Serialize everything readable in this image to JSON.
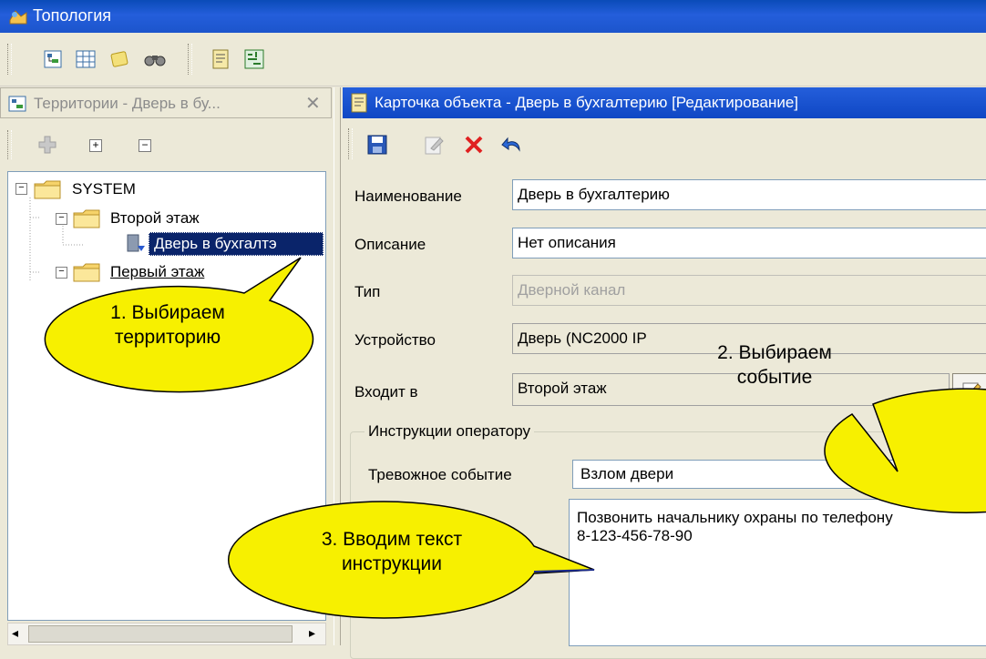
{
  "window": {
    "title": "Топология"
  },
  "left_panel": {
    "title": "Территории - Дверь в бу...",
    "tree": [
      {
        "label": "SYSTEM"
      },
      {
        "label": "Второй этаж"
      },
      {
        "label": "Дверь в бухгалтэ"
      },
      {
        "label": "Первый этаж"
      }
    ]
  },
  "right_panel": {
    "title": "Карточка объекта - Дверь в бухгалтерию [Редактирование]",
    "fields": {
      "name": {
        "label": "Наименование",
        "value": "Дверь в бухгалтерию"
      },
      "description": {
        "label": "Описание",
        "value": "Нет описания"
      },
      "type": {
        "label": "Тип",
        "value": "Дверной канал"
      },
      "device": {
        "label": "Устройство",
        "value": "Дверь (NC2000 IP"
      },
      "parent": {
        "label": "Входит в",
        "value": "Второй этаж"
      }
    },
    "instructions_group": {
      "legend": "Инструкции оператору",
      "alarm_label": "Тревожное событие",
      "alarm_value": "Взлом двери",
      "text": "Позвонить начальнику охраны по телефону\n8-123-456-78-90"
    }
  },
  "callouts": {
    "c1": "1. Выбираем\nтерриторию",
    "c2": "2. Выбираем\nсобытие",
    "c3": "3. Вводим текст\nинструкции"
  },
  "colors": {
    "titlebar": "#245edb",
    "selection": "#0a246a",
    "callout": "#f7f000",
    "delete": "#e02020"
  }
}
